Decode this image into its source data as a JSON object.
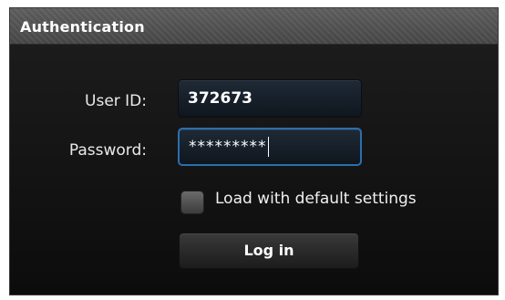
{
  "header": {
    "title": "Authentication"
  },
  "form": {
    "user_id_label": "User ID:",
    "user_id_value": "372673",
    "password_label": "Password:",
    "password_value": "*********",
    "checkbox_label": "Load with default settings",
    "checkbox_checked": false,
    "login_label": "Log in"
  },
  "colors": {
    "focus_border": "#2b6fae",
    "panel_bg": "#141414"
  }
}
